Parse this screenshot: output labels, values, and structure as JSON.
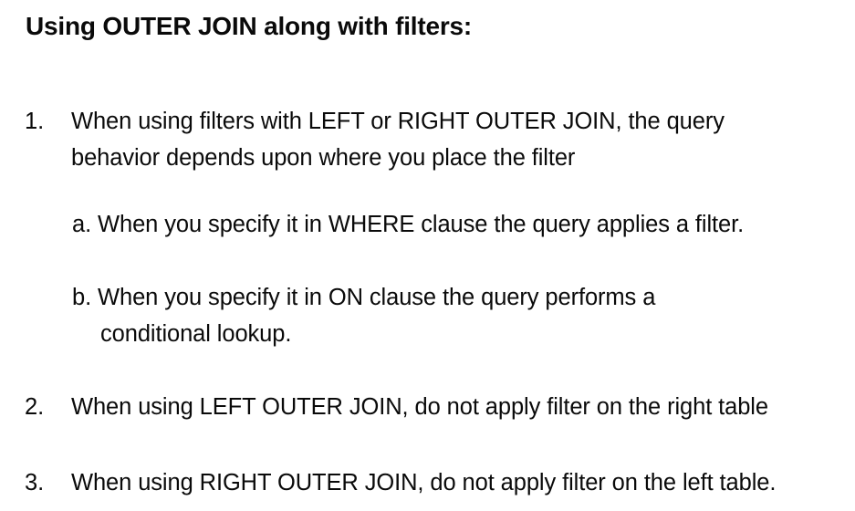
{
  "title": "Using OUTER JOIN along with filters:",
  "items": [
    {
      "number": "1.",
      "lines": [
        "When using filters with LEFT or RIGHT OUTER JOIN, the query",
        "behavior depends upon where you place the filter"
      ],
      "subitems": [
        {
          "lines": [
            "a. When you specify it in WHERE clause the query applies a filter."
          ]
        },
        {
          "lines": [
            "b. When you specify it in ON clause the query performs a",
            "conditional lookup."
          ]
        }
      ]
    },
    {
      "number": "2.",
      "lines": [
        "When using LEFT OUTER JOIN, do not apply filter on the right table"
      ]
    },
    {
      "number": "3.",
      "lines": [
        "When using RIGHT OUTER JOIN, do not apply filter on the left table."
      ]
    }
  ]
}
